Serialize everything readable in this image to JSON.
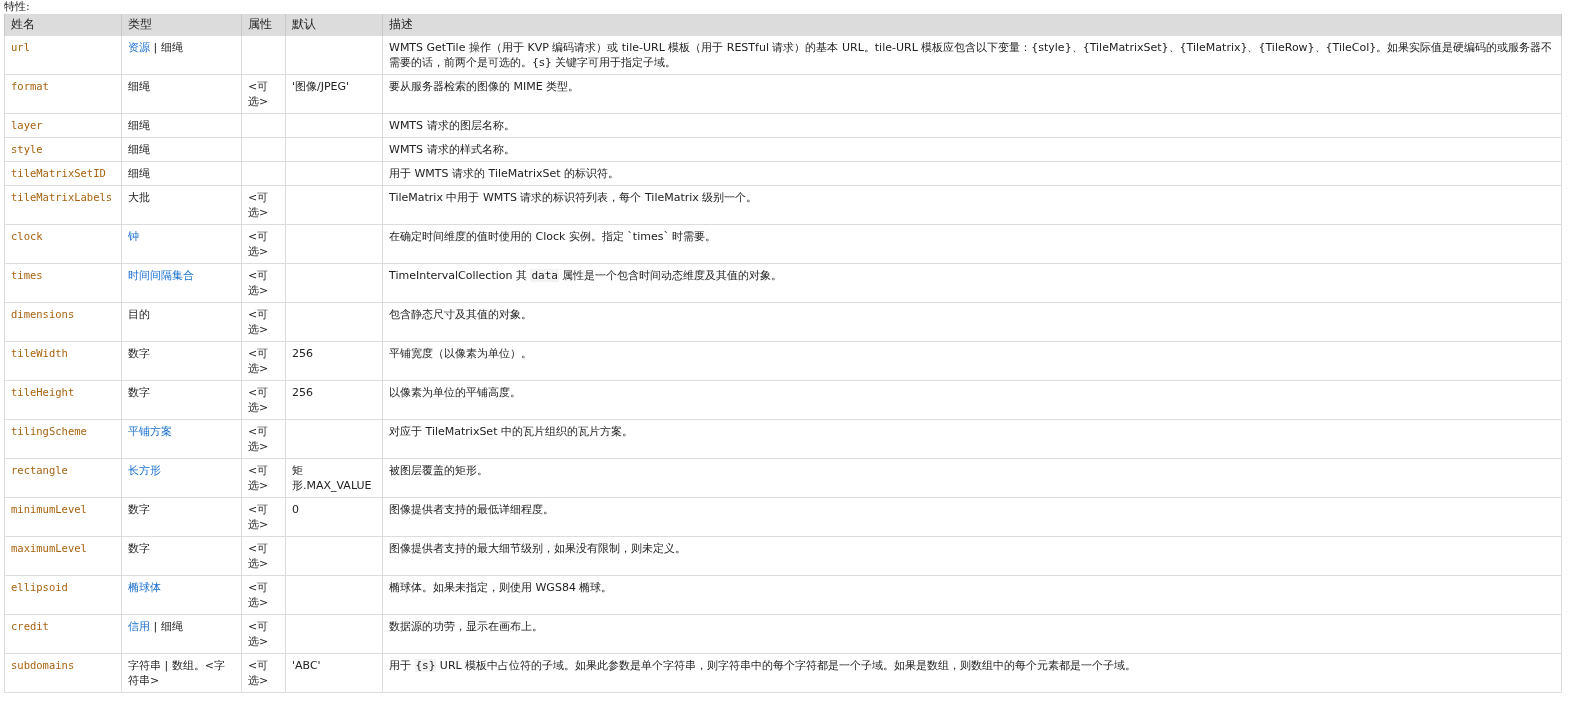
{
  "heading": "特性:",
  "columns": [
    "姓名",
    "类型",
    "属性",
    "默认",
    "描述"
  ],
  "rows": [
    {
      "name": "url",
      "type": [
        {
          "text": "资源",
          "kind": "link"
        },
        {
          "text": " | ",
          "kind": "plain"
        },
        {
          "text": "细绳",
          "kind": "plain"
        }
      ],
      "attribute": "",
      "default": "",
      "description": [
        {
          "text": "WMTS GetTile 操作（用于 KVP 编码请求）或 tile-URL 模板（用于 RESTful 请求）的基本 URL。tile-URL 模板应包含以下变量：{style}、{TileMatrixSet}、{TileMatrix}、{TileRow}、{TileCol}。如果实际值是硬编码的或服务器不需要的话，前两个是可选的。{s} 关键字可用于指定子域。",
          "kind": "text"
        }
      ]
    },
    {
      "name": "format",
      "type": [
        {
          "text": "细绳",
          "kind": "plain"
        }
      ],
      "attribute": "<可选>",
      "default": "'图像/JPEG'",
      "description": [
        {
          "text": "要从服务器检索的图像的 MIME 类型。",
          "kind": "text"
        }
      ]
    },
    {
      "name": "layer",
      "type": [
        {
          "text": "细绳",
          "kind": "plain"
        }
      ],
      "attribute": "",
      "default": "",
      "description": [
        {
          "text": "WMTS 请求的图层名称。",
          "kind": "text"
        }
      ]
    },
    {
      "name": "style",
      "type": [
        {
          "text": "细绳",
          "kind": "plain"
        }
      ],
      "attribute": "",
      "default": "",
      "description": [
        {
          "text": "WMTS 请求的样式名称。",
          "kind": "text"
        }
      ]
    },
    {
      "name": "tileMatrixSetID",
      "type": [
        {
          "text": "细绳",
          "kind": "plain"
        }
      ],
      "attribute": "",
      "default": "",
      "description": [
        {
          "text": "用于 WMTS 请求的 TileMatrixSet 的标识符。",
          "kind": "text"
        }
      ]
    },
    {
      "name": "tileMatrixLabels",
      "type": [
        {
          "text": "大批",
          "kind": "plain"
        }
      ],
      "attribute": "<可选>",
      "default": "",
      "description": [
        {
          "text": "TileMatrix 中用于 WMTS 请求的标识符列表，每个 TileMatrix 级别一个。",
          "kind": "text"
        }
      ]
    },
    {
      "name": "clock",
      "type": [
        {
          "text": "钟",
          "kind": "link"
        }
      ],
      "attribute": "<可选>",
      "default": "",
      "description": [
        {
          "text": "在确定时间维度的值时使用的 Clock 实例。指定 `times` 时需要。",
          "kind": "text"
        }
      ]
    },
    {
      "name": "times",
      "type": [
        {
          "text": "时间间隔集合",
          "kind": "link"
        }
      ],
      "attribute": "<可选>",
      "default": "",
      "description": [
        {
          "text": "TimeIntervalCollection 其 ",
          "kind": "text"
        },
        {
          "text": "data",
          "kind": "code"
        },
        {
          "text": " 属性是一个包含时间动态维度及其值的对象。",
          "kind": "text"
        }
      ]
    },
    {
      "name": "dimensions",
      "type": [
        {
          "text": "目的",
          "kind": "plain"
        }
      ],
      "attribute": "<可选>",
      "default": "",
      "description": [
        {
          "text": "包含静态尺寸及其值的对象。",
          "kind": "text"
        }
      ]
    },
    {
      "name": "tileWidth",
      "type": [
        {
          "text": "数字",
          "kind": "plain"
        }
      ],
      "attribute": "<可选>",
      "default": "256",
      "description": [
        {
          "text": "平铺宽度（以像素为单位）。",
          "kind": "text"
        }
      ]
    },
    {
      "name": "tileHeight",
      "type": [
        {
          "text": "数字",
          "kind": "plain"
        }
      ],
      "attribute": "<可选>",
      "default": "256",
      "description": [
        {
          "text": "以像素为单位的平铺高度。",
          "kind": "text"
        }
      ]
    },
    {
      "name": "tilingScheme",
      "type": [
        {
          "text": "平铺方案",
          "kind": "link"
        }
      ],
      "attribute": "<可选>",
      "default": "",
      "description": [
        {
          "text": "对应于 TileMatrixSet 中的瓦片组织的瓦片方案。",
          "kind": "text"
        }
      ]
    },
    {
      "name": "rectangle",
      "type": [
        {
          "text": "长方形",
          "kind": "link"
        }
      ],
      "attribute": "<可选>",
      "default": "矩形.MAX_VALUE",
      "description": [
        {
          "text": "被图层覆盖的矩形。",
          "kind": "text"
        }
      ]
    },
    {
      "name": "minimumLevel",
      "type": [
        {
          "text": "数字",
          "kind": "plain"
        }
      ],
      "attribute": "<可选>",
      "default": "0",
      "description": [
        {
          "text": "图像提供者支持的最低详细程度。",
          "kind": "text"
        }
      ]
    },
    {
      "name": "maximumLevel",
      "type": [
        {
          "text": "数字",
          "kind": "plain"
        }
      ],
      "attribute": "<可选>",
      "default": "",
      "description": [
        {
          "text": "图像提供者支持的最大细节级别，如果没有限制，则未定义。",
          "kind": "text"
        }
      ]
    },
    {
      "name": "ellipsoid",
      "type": [
        {
          "text": "椭球体",
          "kind": "link"
        }
      ],
      "attribute": "<可选>",
      "default": "",
      "description": [
        {
          "text": "椭球体。如果未指定，则使用 WGS84 椭球。",
          "kind": "text"
        }
      ]
    },
    {
      "name": "credit",
      "type": [
        {
          "text": "信用",
          "kind": "link"
        },
        {
          "text": " | ",
          "kind": "plain"
        },
        {
          "text": "细绳",
          "kind": "plain"
        }
      ],
      "attribute": "<可选>",
      "default": "",
      "description": [
        {
          "text": "数据源的功劳，显示在画布上。",
          "kind": "text"
        }
      ]
    },
    {
      "name": "subdomains",
      "type": [
        {
          "text": "字符串 | 数组。<字符串>",
          "kind": "plain"
        }
      ],
      "attribute": "<可选>",
      "default": "'ABC'",
      "description": [
        {
          "text": "用于 ",
          "kind": "text"
        },
        {
          "text": "{s}",
          "kind": "code"
        },
        {
          "text": " URL 模板中占位符的子域。如果此参数是单个字符串，则字符串中的每个字符都是一个子域。如果是数组，则数组中的每个元素都是一个子域。",
          "kind": "text"
        }
      ]
    }
  ]
}
